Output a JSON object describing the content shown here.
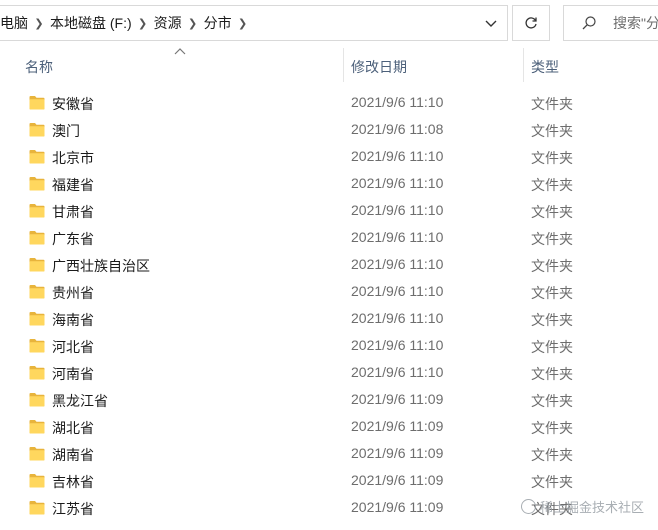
{
  "breadcrumb": [
    {
      "label": "电脑"
    },
    {
      "label": "本地磁盘 (F:)"
    },
    {
      "label": "资源"
    },
    {
      "label": "分市"
    }
  ],
  "search": {
    "placeholder": "搜索\"分"
  },
  "columns": {
    "name": "名称",
    "date": "修改日期",
    "type": "类型"
  },
  "files": [
    {
      "name": "安徽省",
      "date": "2021/9/6 11:10",
      "type": "文件夹"
    },
    {
      "name": "澳门",
      "date": "2021/9/6 11:08",
      "type": "文件夹"
    },
    {
      "name": "北京市",
      "date": "2021/9/6 11:10",
      "type": "文件夹"
    },
    {
      "name": "福建省",
      "date": "2021/9/6 11:10",
      "type": "文件夹"
    },
    {
      "name": "甘肃省",
      "date": "2021/9/6 11:10",
      "type": "文件夹"
    },
    {
      "name": "广东省",
      "date": "2021/9/6 11:10",
      "type": "文件夹"
    },
    {
      "name": "广西壮族自治区",
      "date": "2021/9/6 11:10",
      "type": "文件夹"
    },
    {
      "name": "贵州省",
      "date": "2021/9/6 11:10",
      "type": "文件夹"
    },
    {
      "name": "海南省",
      "date": "2021/9/6 11:10",
      "type": "文件夹"
    },
    {
      "name": "河北省",
      "date": "2021/9/6 11:10",
      "type": "文件夹"
    },
    {
      "name": "河南省",
      "date": "2021/9/6 11:10",
      "type": "文件夹"
    },
    {
      "name": "黑龙江省",
      "date": "2021/9/6 11:09",
      "type": "文件夹"
    },
    {
      "name": "湖北省",
      "date": "2021/9/6 11:09",
      "type": "文件夹"
    },
    {
      "name": "湖南省",
      "date": "2021/9/6 11:09",
      "type": "文件夹"
    },
    {
      "name": "吉林省",
      "date": "2021/9/6 11:09",
      "type": "文件夹"
    },
    {
      "name": "江苏省",
      "date": "2021/9/6 11:09",
      "type": "文件夹"
    }
  ],
  "watermark": {
    "text": "稀土掘金技术社区"
  },
  "colors": {
    "folder": "#FFD75E",
    "folder_dark": "#E8B43C",
    "header_text": "#4C607A",
    "secondary_text": "#6D6D6D"
  },
  "icons": {
    "folder": "folder-icon",
    "breadcrumb_separator": "chevron-right-icon",
    "dropdown": "chevron-down-icon",
    "refresh": "refresh-icon",
    "search": "search-icon",
    "sort": "sort-ascending-icon"
  }
}
